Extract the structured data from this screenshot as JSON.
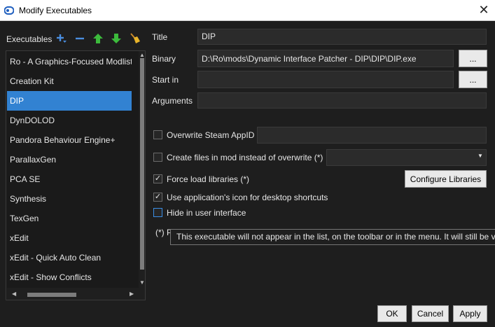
{
  "window": {
    "title": "Modify Executables",
    "close_icon": "close-icon"
  },
  "colors": {
    "selection": "#3282d2",
    "background": "#1e1e1e",
    "field": "#2b2b2b",
    "add_icon": "#4a8ee0",
    "remove_icon": "#4a8ee0",
    "up_arrow": "#3cbb3c",
    "down_arrow": "#3cbb3c",
    "broom": "#e8b42a"
  },
  "sidebar": {
    "header": "Executables",
    "toolbar": [
      "add-icon",
      "remove-icon",
      "move-up-icon",
      "move-down-icon",
      "broom-icon"
    ],
    "items": [
      {
        "label": "Ro - A Graphics-Focused Modlist",
        "selected": false
      },
      {
        "label": "Creation Kit",
        "selected": false
      },
      {
        "label": "DIP",
        "selected": true
      },
      {
        "label": "DynDOLOD",
        "selected": false
      },
      {
        "label": "Pandora Behaviour Engine+",
        "selected": false
      },
      {
        "label": "ParallaxGen",
        "selected": false
      },
      {
        "label": "PCA SE",
        "selected": false
      },
      {
        "label": "Synthesis",
        "selected": false
      },
      {
        "label": "TexGen",
        "selected": false
      },
      {
        "label": "xEdit",
        "selected": false
      },
      {
        "label": "xEdit - Quick Auto Clean",
        "selected": false
      },
      {
        "label": "xEdit - Show Conflicts",
        "selected": false
      }
    ]
  },
  "form": {
    "title_label": "Title",
    "title_value": "DIP",
    "binary_label": "Binary",
    "binary_value": "D:\\Ro\\mods\\Dynamic Interface Patcher - DIP\\DIP\\DIP.exe",
    "browse_label": "...",
    "start_in_label": "Start in",
    "start_in_value": "",
    "arguments_label": "Arguments",
    "arguments_value": "",
    "overwrite_steam_label": "Overwrite Steam AppID",
    "overwrite_steam_checked": false,
    "overwrite_steam_value": "",
    "create_files_label": "Create files in mod instead of overwrite (*)",
    "create_files_checked": false,
    "create_files_value": "",
    "force_load_label": "Force load libraries (*)",
    "force_load_checked": true,
    "configure_libraries_label": "Configure Libraries",
    "use_icon_label": "Use application's icon for desktop shortcuts",
    "use_icon_checked": true,
    "hide_label": "Hide in user interface",
    "hide_checked": false,
    "footnote_visible": "(*) P"
  },
  "tooltip": {
    "text": "This executable will not appear in the list, on the toolbar or in the menu. It will still be v"
  },
  "buttons": {
    "ok": "OK",
    "cancel": "Cancel",
    "apply": "Apply"
  }
}
